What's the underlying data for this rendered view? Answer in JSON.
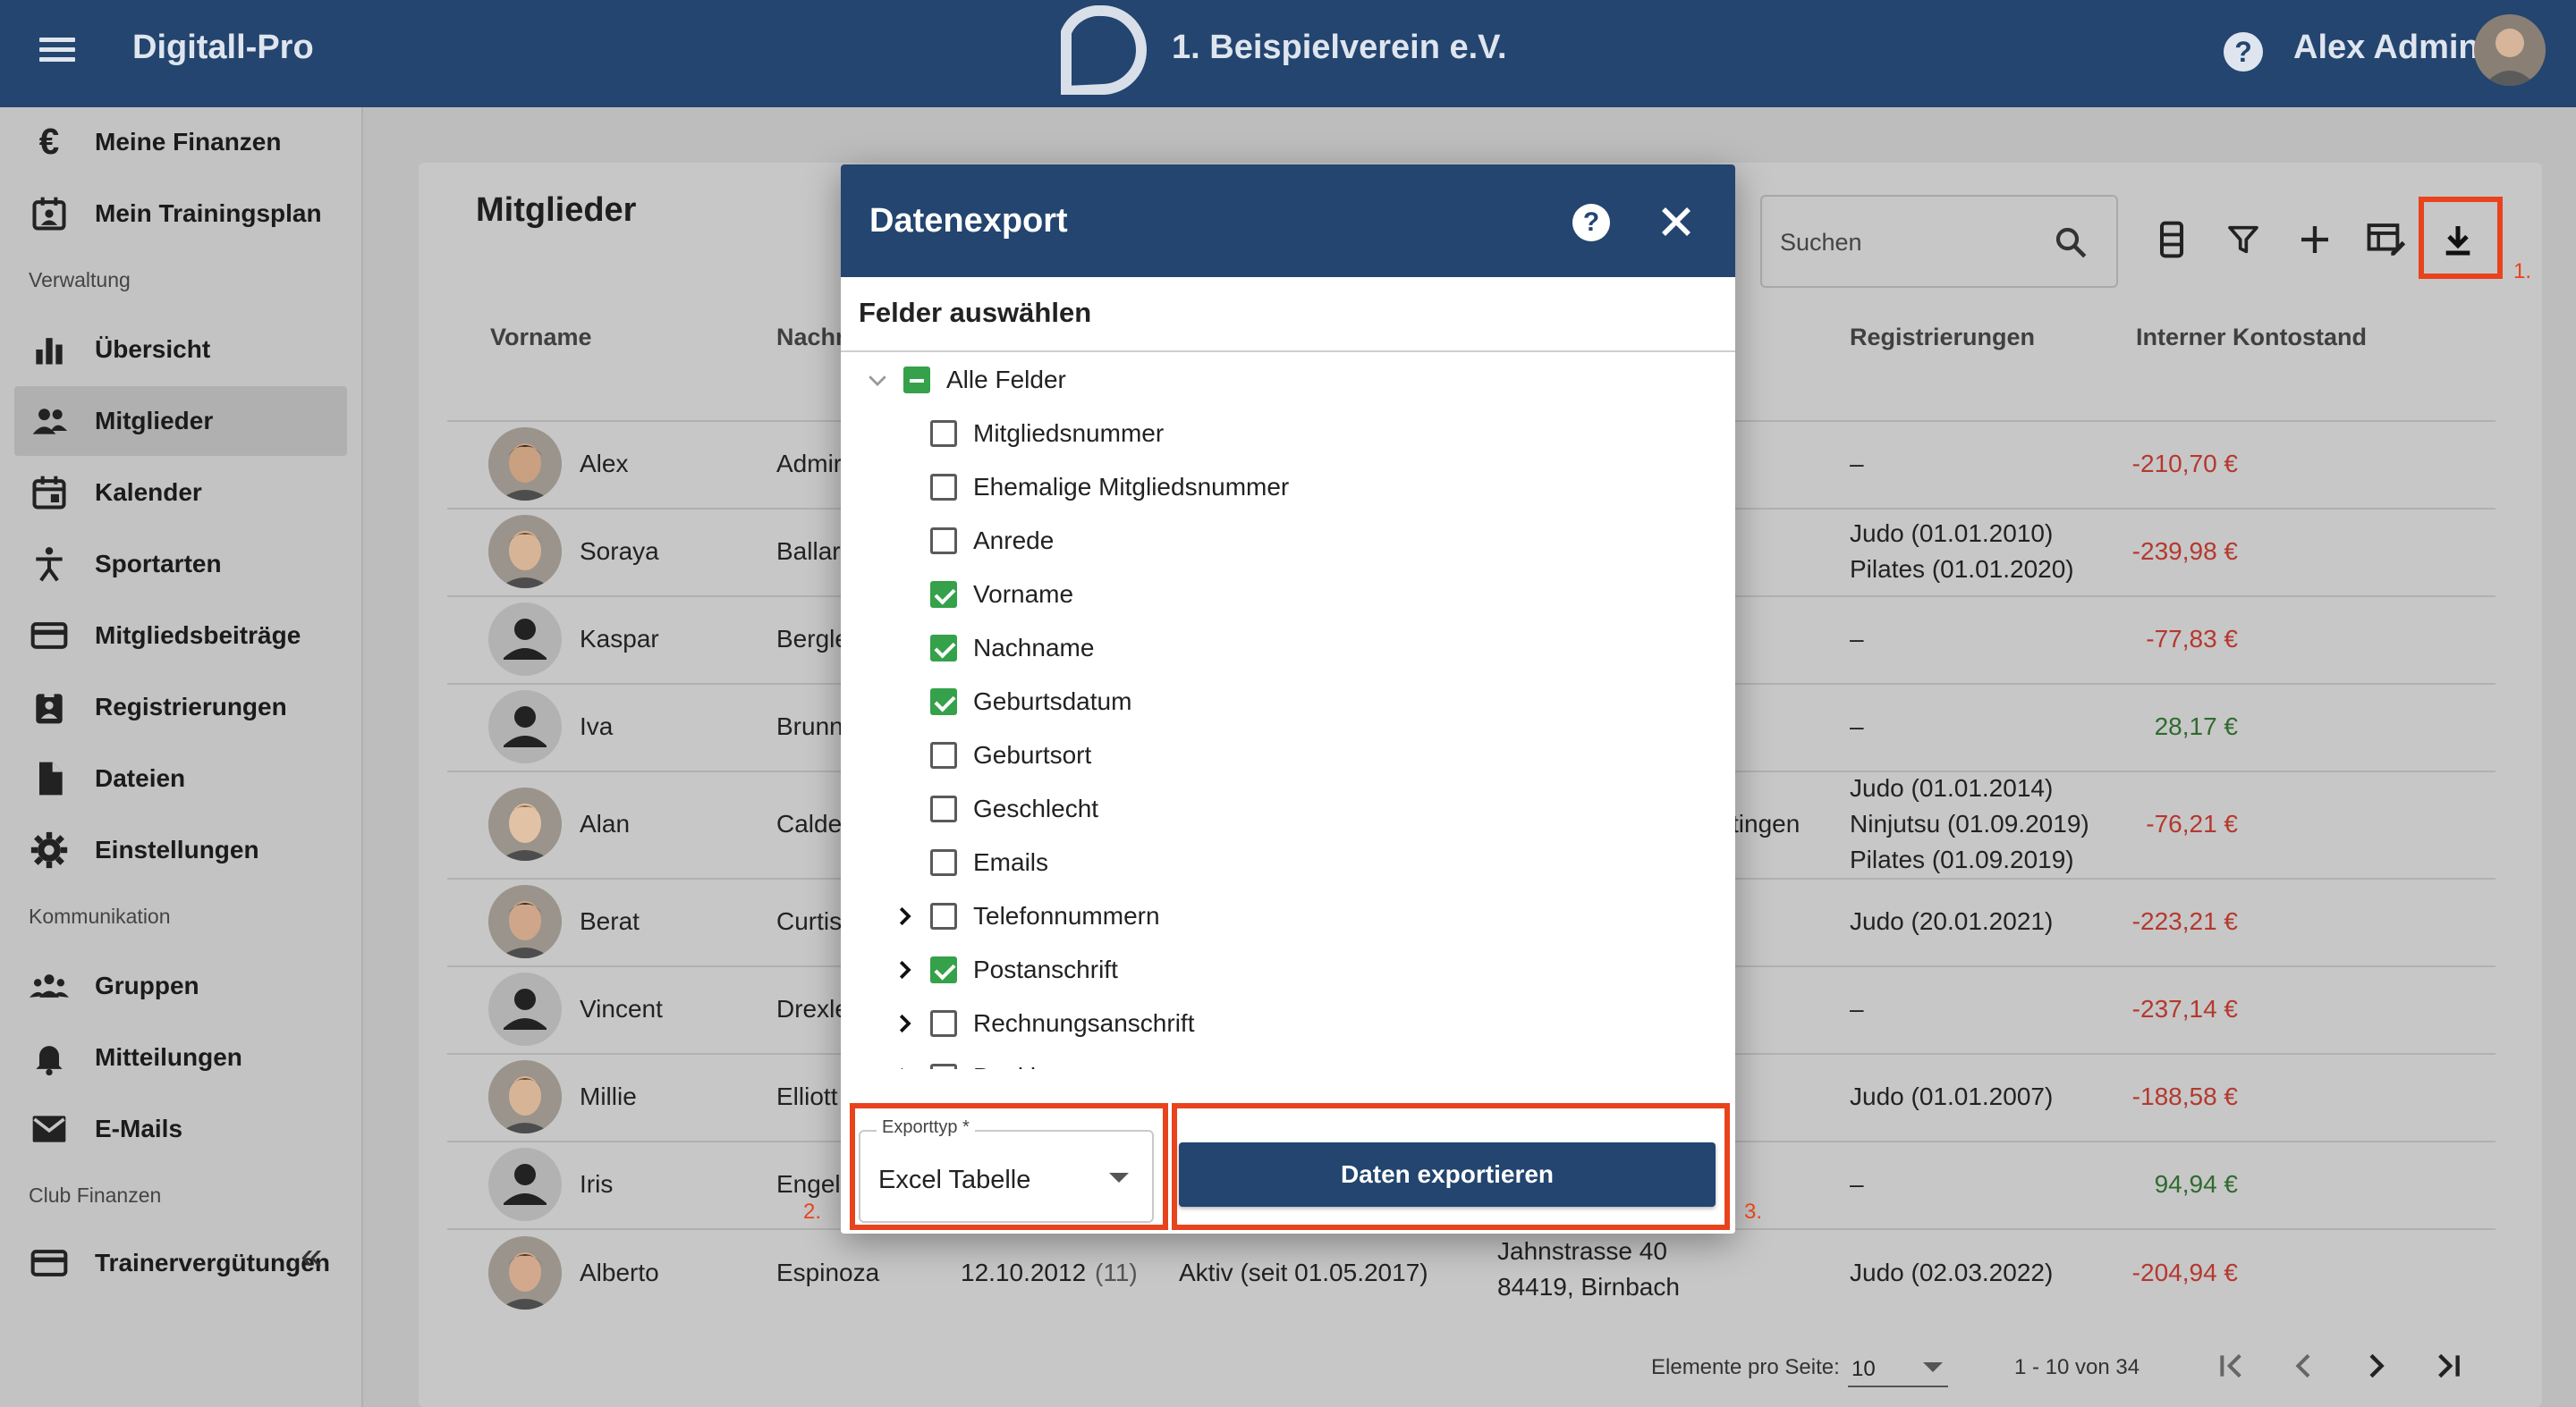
{
  "header": {
    "brand": "Digitall-Pro",
    "club_name": "1. Beispielverein e.V.",
    "user_name": "Alex Admin"
  },
  "sidebar": {
    "items": [
      {
        "label": "Meine Finanzen",
        "icon": "euro-icon"
      },
      {
        "label": "Mein Trainingsplan",
        "icon": "calendar-user-icon"
      },
      {
        "label": "Übersicht",
        "icon": "bar-chart-icon"
      },
      {
        "label": "Mitglieder",
        "icon": "people-icon",
        "active": true
      },
      {
        "label": "Kalender",
        "icon": "calendar-icon"
      },
      {
        "label": "Sportarten",
        "icon": "sport-icon"
      },
      {
        "label": "Mitgliedsbeiträge",
        "icon": "credit-card-icon"
      },
      {
        "label": "Registrierungen",
        "icon": "clipboard-icon"
      },
      {
        "label": "Dateien",
        "icon": "file-icon"
      },
      {
        "label": "Einstellungen",
        "icon": "gear-icon"
      },
      {
        "label": "Gruppen",
        "icon": "groups-icon"
      },
      {
        "label": "Mitteilungen",
        "icon": "bell-icon"
      },
      {
        "label": "E-Mails",
        "icon": "mail-icon"
      },
      {
        "label": "Trainervergütungen",
        "icon": "credit-card-icon"
      }
    ],
    "sections": [
      "Verwaltung",
      "Kommunikation",
      "Club Finanzen"
    ],
    "collapse_label": "«"
  },
  "main": {
    "title": "Mitglieder",
    "search_placeholder": "Suchen",
    "columns": {
      "vorname": "Vorname",
      "nachname": "Nachn",
      "registrierungen": "Registrierungen",
      "kontostand": "Interner Kontostand"
    },
    "rows": [
      {
        "vorname": "Alex",
        "nachname": "Admir",
        "reg": [
          "–"
        ],
        "konto": "-210,70 €",
        "neg": true
      },
      {
        "vorname": "Soraya",
        "nachname": "Ballar",
        "reg": [
          "Judo (01.01.2010)",
          "Pilates (01.01.2020)"
        ],
        "konto": "-239,98 €",
        "neg": true
      },
      {
        "vorname": "Kaspar",
        "nachname": "Bergle",
        "reg": [
          "–"
        ],
        "konto": "-77,83 €",
        "neg": true
      },
      {
        "vorname": "Iva",
        "nachname": "Brunn",
        "reg": [
          "–"
        ],
        "konto": "28,17 €",
        "neg": false
      },
      {
        "vorname": "Alan",
        "nachname": "Calde",
        "reg": [
          "Judo (01.01.2014)",
          "Ninjutsu (01.09.2019)",
          "Pilates (01.09.2019)"
        ],
        "konto": "-76,21 €",
        "neg": true,
        "extra": "tingen"
      },
      {
        "vorname": "Berat",
        "nachname": "Curtis",
        "reg": [
          "Judo (20.01.2021)"
        ],
        "konto": "-223,21 €",
        "neg": true
      },
      {
        "vorname": "Vincent",
        "nachname": "Drexle",
        "reg": [
          "–"
        ],
        "konto": "-237,14 €",
        "neg": true
      },
      {
        "vorname": "Millie",
        "nachname": "Elliott",
        "reg": [
          "Judo (01.01.2007)"
        ],
        "konto": "-188,58 €",
        "neg": true
      },
      {
        "vorname": "Iris",
        "nachname": "Engell",
        "reg": [
          "–"
        ],
        "konto": "94,94 €",
        "neg": false
      },
      {
        "vorname": "Alberto",
        "nachname": "Espinoza",
        "geburt": "12.10.2012",
        "alter": "(11)",
        "status": "Aktiv  (seit 01.05.2017)",
        "addr": [
          "Jahnstrasse 40",
          "84419, Birnbach"
        ],
        "reg": [
          "Judo (02.03.2022)"
        ],
        "konto": "-204,94 €",
        "neg": true
      }
    ],
    "pagination": {
      "per_page_label": "Elemente pro Seite:",
      "per_page_value": "10",
      "range": "1 - 10 von 34"
    }
  },
  "annotations": [
    "1.",
    "2.",
    "3."
  ],
  "dialog": {
    "title": "Datenexport",
    "subtitle": "Felder auswählen",
    "fields": [
      {
        "label": "Alle Felder",
        "state": "partial",
        "level": 0,
        "expander": "collapse"
      },
      {
        "label": "Mitgliedsnummer",
        "state": "off",
        "level": 1
      },
      {
        "label": "Ehemalige Mitgliedsnummer",
        "state": "off",
        "level": 1
      },
      {
        "label": "Anrede",
        "state": "off",
        "level": 1
      },
      {
        "label": "Vorname",
        "state": "on",
        "level": 1
      },
      {
        "label": "Nachname",
        "state": "on",
        "level": 1
      },
      {
        "label": "Geburtsdatum",
        "state": "on",
        "level": 1
      },
      {
        "label": "Geburtsort",
        "state": "off",
        "level": 1
      },
      {
        "label": "Geschlecht",
        "state": "off",
        "level": 1
      },
      {
        "label": "Emails",
        "state": "off",
        "level": 1
      },
      {
        "label": "Telefonnummern",
        "state": "off",
        "level": 1,
        "expander": "expand"
      },
      {
        "label": "Postanschrift",
        "state": "on",
        "level": 1,
        "expander": "expand"
      },
      {
        "label": "Rechnungsanschrift",
        "state": "off",
        "level": 1,
        "expander": "expand"
      },
      {
        "label": "Bankkonto",
        "state": "off",
        "level": 1,
        "expander": "expand"
      }
    ],
    "export_type_label": "Exporttyp *",
    "export_type_value": "Excel Tabelle",
    "export_button": "Daten exportieren"
  },
  "colors": {
    "primary": "#23456f",
    "checkbox_on": "#35a14a",
    "negative": "#b5382e",
    "positive": "#2f6b2f",
    "highlight": "#e8431c"
  }
}
